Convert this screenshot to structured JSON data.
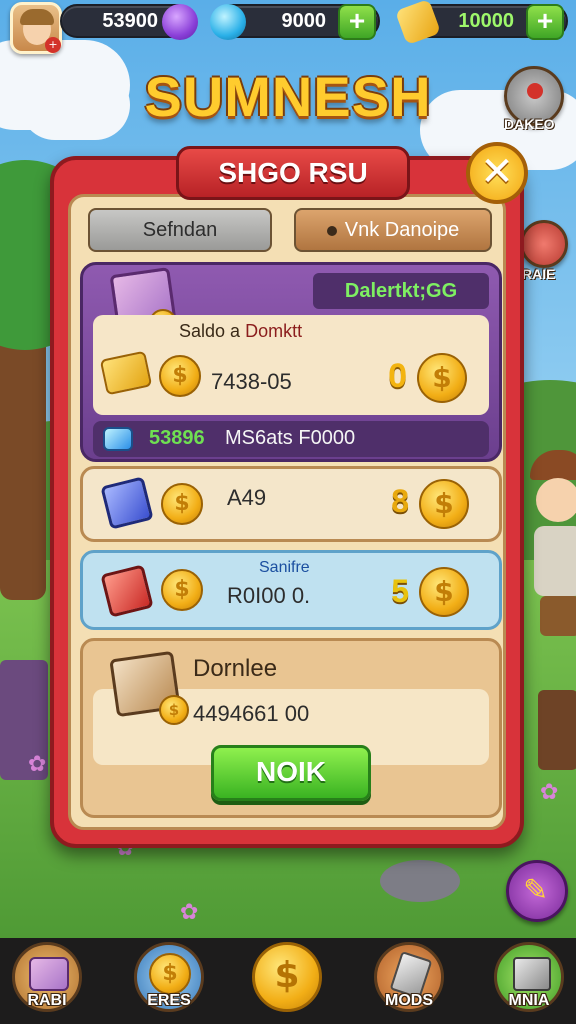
{
  "hud": {
    "player_avatar": "player-portrait",
    "currency_1": "53900",
    "currency_2": "9000",
    "currency_3": "10000",
    "currency_1_icon": "purple-gem-icon",
    "currency_2_icon": "blue-crystal-icon",
    "currency_3_icon": "gold-bar-icon"
  },
  "game_title": "SUMNESH",
  "side_buttons": {
    "top_label": "DAKEO",
    "mid_label": "RAIE"
  },
  "dialog": {
    "header": "SHGO RSU",
    "tabs": [
      "Sefndan",
      "Vnk Danoipe"
    ],
    "featured": {
      "badge": "Dalertkt;GG",
      "subtitle_prefix": "Saldo a",
      "subtitle_accent": "Domktt",
      "price": "7438-05",
      "count": "0",
      "footer_green": "53896",
      "footer_text": "MS6ats F0000"
    },
    "items": [
      {
        "label": "A49",
        "count": "8",
        "title": ""
      },
      {
        "label": "R0I00 0.",
        "count": "5",
        "title": "Sanifre"
      }
    ],
    "panel": {
      "title": "Dornlee",
      "amount": "4494661 00",
      "button": "NOIK"
    }
  },
  "bottom_nav": [
    {
      "label": "RABI",
      "icon": "treasure-chest-icon"
    },
    {
      "label": "ERES",
      "icon": "gold-coin-icon"
    },
    {
      "label": "",
      "icon": "coin-shop-icon"
    },
    {
      "label": "MODS",
      "icon": "tools-icon"
    },
    {
      "label": "MNIA",
      "icon": "gift-box-icon"
    }
  ],
  "colors": {
    "dialog_red": "#d8333a",
    "panel_tan": "#f4dfb4",
    "featured_purple": "#8f5ab0",
    "confirm_green": "#3ab322",
    "coin_gold": "#f2ae16"
  }
}
